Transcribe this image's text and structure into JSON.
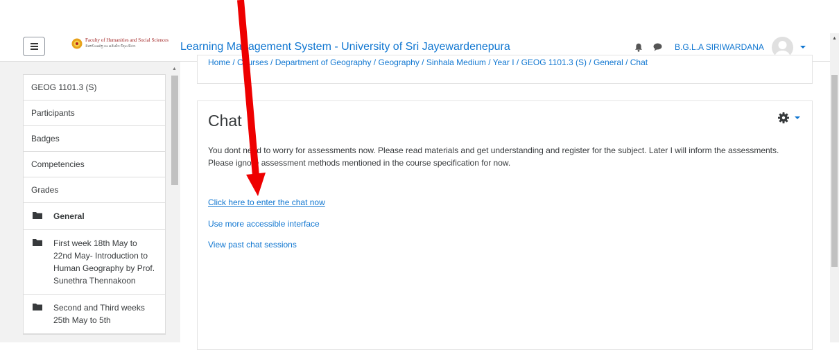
{
  "header": {
    "site_name": "Learning Management System - University of Sri Jayewardenepura",
    "logo_line1": "Faculty of Humanities and Social Sciences",
    "logo_line2": "මානවශාස්ත්‍ර හා සමාජීය විද්‍යා පීඨය",
    "user_name": "B.G.L.A SIRIWARDANA"
  },
  "breadcrumb": "Home / Courses / Department of Geography / Geography / Sinhala Medium / Year I / GEOG 1101.3 (S) / General / Chat",
  "drawer": {
    "items": [
      {
        "label": "GEOG 1101.3 (S)"
      },
      {
        "label": "Participants"
      },
      {
        "label": "Badges"
      },
      {
        "label": "Competencies"
      },
      {
        "label": "Grades"
      }
    ],
    "sections": [
      {
        "label": "General"
      },
      {
        "label": "First week 18th May to 22nd May- Introduction to Human Geography by Prof. Sunethra Thennakoon"
      },
      {
        "label": "Second and Third weeks 25th May to 5th"
      }
    ]
  },
  "main": {
    "title": "Chat",
    "intro": [
      "You dont need to worry for assessments now. Please read materials and get understanding and register for the subject. Later I will inform the assessments.",
      "Please ignore assessment methods mentioned in the course specification for now."
    ],
    "links": {
      "enter_chat": "Click here to enter the chat now",
      "accessible": "Use more accessible interface",
      "past_sessions": "View past chat sessions"
    }
  },
  "colors": {
    "link": "#1177d1",
    "annotation_arrow": "#ee0000"
  },
  "icons": [
    "menu-icon",
    "bell-icon",
    "chat-bubble-icon",
    "gear-icon",
    "folder-icon"
  ]
}
